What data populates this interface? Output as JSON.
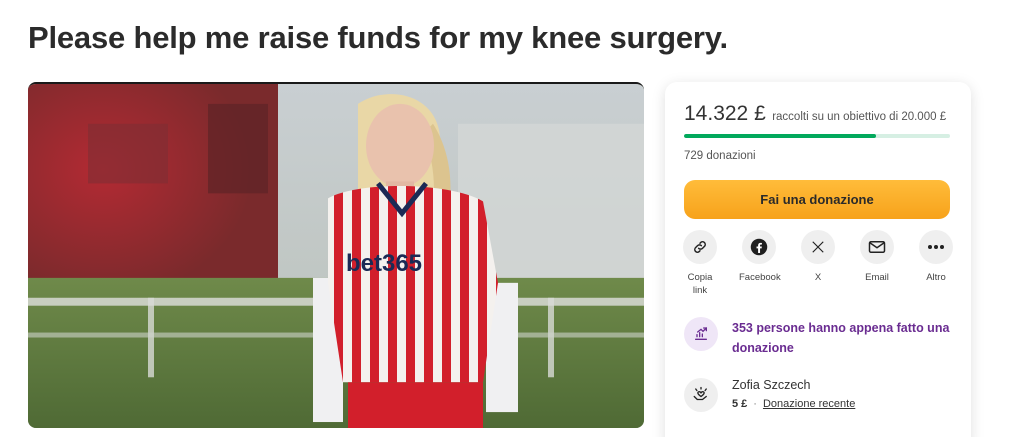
{
  "campaign": {
    "title": "Please help me raise funds for my knee surgery.",
    "image_alt": "Player in a red and white striped bet365 football shirt",
    "shirt_sponsor": "bet365"
  },
  "donation_card": {
    "raised_amount": "14.322 £",
    "goal_text": "raccolti su un obiettivo di 20.000 £",
    "progress_fraction": 0.72,
    "donation_count": "729 donazioni",
    "donate_button": "Fai una donazione",
    "share_options": [
      {
        "label": "Copia link",
        "icon": "link-icon"
      },
      {
        "label": "Facebook",
        "icon": "facebook-icon"
      },
      {
        "label": "X",
        "icon": "x-icon"
      },
      {
        "label": "Email",
        "icon": "email-icon"
      },
      {
        "label": "Altro",
        "icon": "more-icon"
      }
    ],
    "recent_activity": {
      "text": "353 persone hanno appena fatto una donazione",
      "icon": "trending-icon"
    },
    "recent_donor": {
      "name": "Zofia Szczech",
      "amount": "5 £",
      "separator": "·",
      "tag": "Donazione recente",
      "icon": "hands-heart-icon"
    }
  },
  "colors": {
    "progress_green": "#02a95c",
    "donate_orange": "#f7a21b",
    "accent_purple": "#6a2c91"
  }
}
